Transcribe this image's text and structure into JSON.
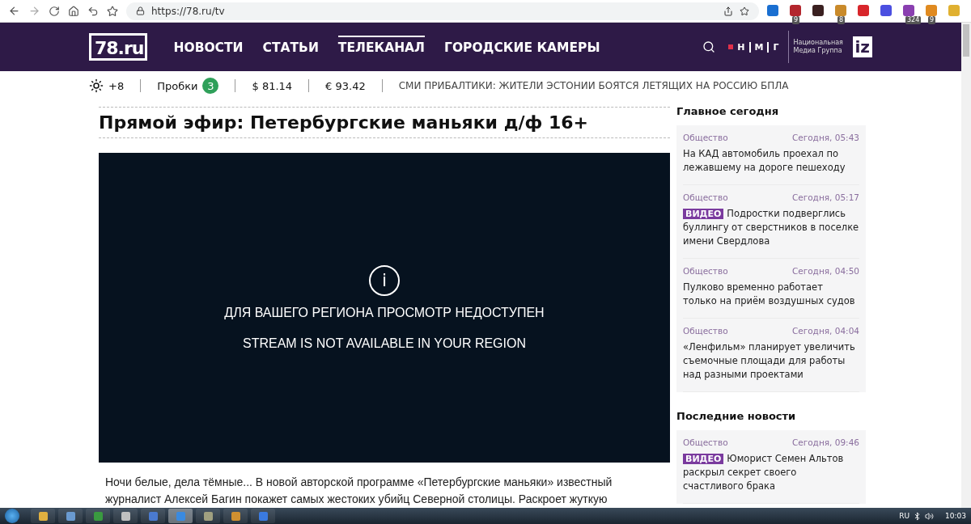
{
  "browser": {
    "url": "https://78.ru/tv",
    "extensions": [
      {
        "color": "#1a6fd1"
      },
      {
        "color": "#b3262d",
        "badge": "9"
      },
      {
        "color": "#3a2020"
      },
      {
        "color": "#c98a2a",
        "badge": "8"
      },
      {
        "color": "#d8262b"
      },
      {
        "color": "#4b4fe0"
      },
      {
        "color": "#8a3fb0",
        "badge": "324"
      },
      {
        "color": "#e08a20",
        "badge": "9"
      },
      {
        "color": "#e0b030"
      }
    ]
  },
  "header": {
    "logo": "78.ru",
    "nav": [
      {
        "label": "НОВОСТИ",
        "selected": false
      },
      {
        "label": "СТАТЬИ",
        "selected": false
      },
      {
        "label": "ТЕЛЕКАНАЛ",
        "selected": true
      },
      {
        "label": "ГОРОДСКИЕ КАМЕРЫ",
        "selected": false
      }
    ],
    "partner_letters": [
      "Н",
      "М",
      "Г"
    ],
    "partner_name": "Национальная Медиа Группа",
    "partner_logo": "iz"
  },
  "ticker": {
    "temperature": "+8",
    "traffic_label": "Пробки",
    "traffic_level": "3",
    "usd": "$ 81.14",
    "eur": "€ 93.42",
    "headline": "СМИ ПРИБАЛТИКИ: ЖИТЕЛИ ЭСТОНИИ БОЯТСЯ ЛЕТЯЩИХ НА РОССИЮ БПЛА"
  },
  "title": "Прямой эфир: Петербургские маньяки д/ф 16+",
  "player": {
    "info_mark": "i",
    "messages": [
      "ДЛЯ ВАШЕГО РЕГИОНА ПРОСМОТР НЕДОСТУПЕН",
      "STREAM IS NOT AVAILABLE IN YOUR REGION"
    ]
  },
  "description": "Ночи белые, дела тёмные... В новой авторской программе «Петербургские маньяки» известный журналист Алексей Багин покажет самых жестоких убийц Северной столицы. Раскроет жуткую",
  "sidebar": [
    {
      "heading": "Главное сегодня",
      "items": [
        {
          "category": "Общество",
          "time": "Сегодня, 05:43",
          "title": "На КАД автомобиль проехал по лежавшему на дороге пешеходу"
        },
        {
          "category": "Общество",
          "time": "Сегодня, 05:17",
          "badge": "ВИДЕО",
          "title": "Подростки подверглись буллингу от сверстников в поселке имени Свердлова"
        },
        {
          "category": "Общество",
          "time": "Сегодня, 04:50",
          "title": "Пулково временно работает только на приём воздушных судов"
        },
        {
          "category": "Общество",
          "time": "Сегодня, 04:04",
          "title": "«Ленфильм» планирует увеличить съемочные площади для работы над разными проектами"
        }
      ]
    },
    {
      "heading": "Последние новости",
      "items": [
        {
          "category": "Общество",
          "time": "Сегодня, 09:46",
          "badge": "ВИДЕО",
          "title": "Юморист Семен Альтов раскрыл секрет своего счастливого брака"
        }
      ]
    }
  ],
  "taskbar": {
    "apps": [
      {
        "color": "#e0b040",
        "selected": false
      },
      {
        "color": "#6a9ad0",
        "selected": false
      },
      {
        "color": "#3a9a40",
        "selected": false
      },
      {
        "color": "#c0c0c0",
        "selected": false
      },
      {
        "color": "#4a7ad0",
        "selected": false
      },
      {
        "color": "#3a8ae0",
        "selected": true
      },
      {
        "color": "#a0a080",
        "selected": false
      },
      {
        "color": "#d09030",
        "selected": false
      },
      {
        "color": "#3a7ae0",
        "selected": false
      }
    ],
    "language": "RU",
    "clock": "10:03"
  }
}
